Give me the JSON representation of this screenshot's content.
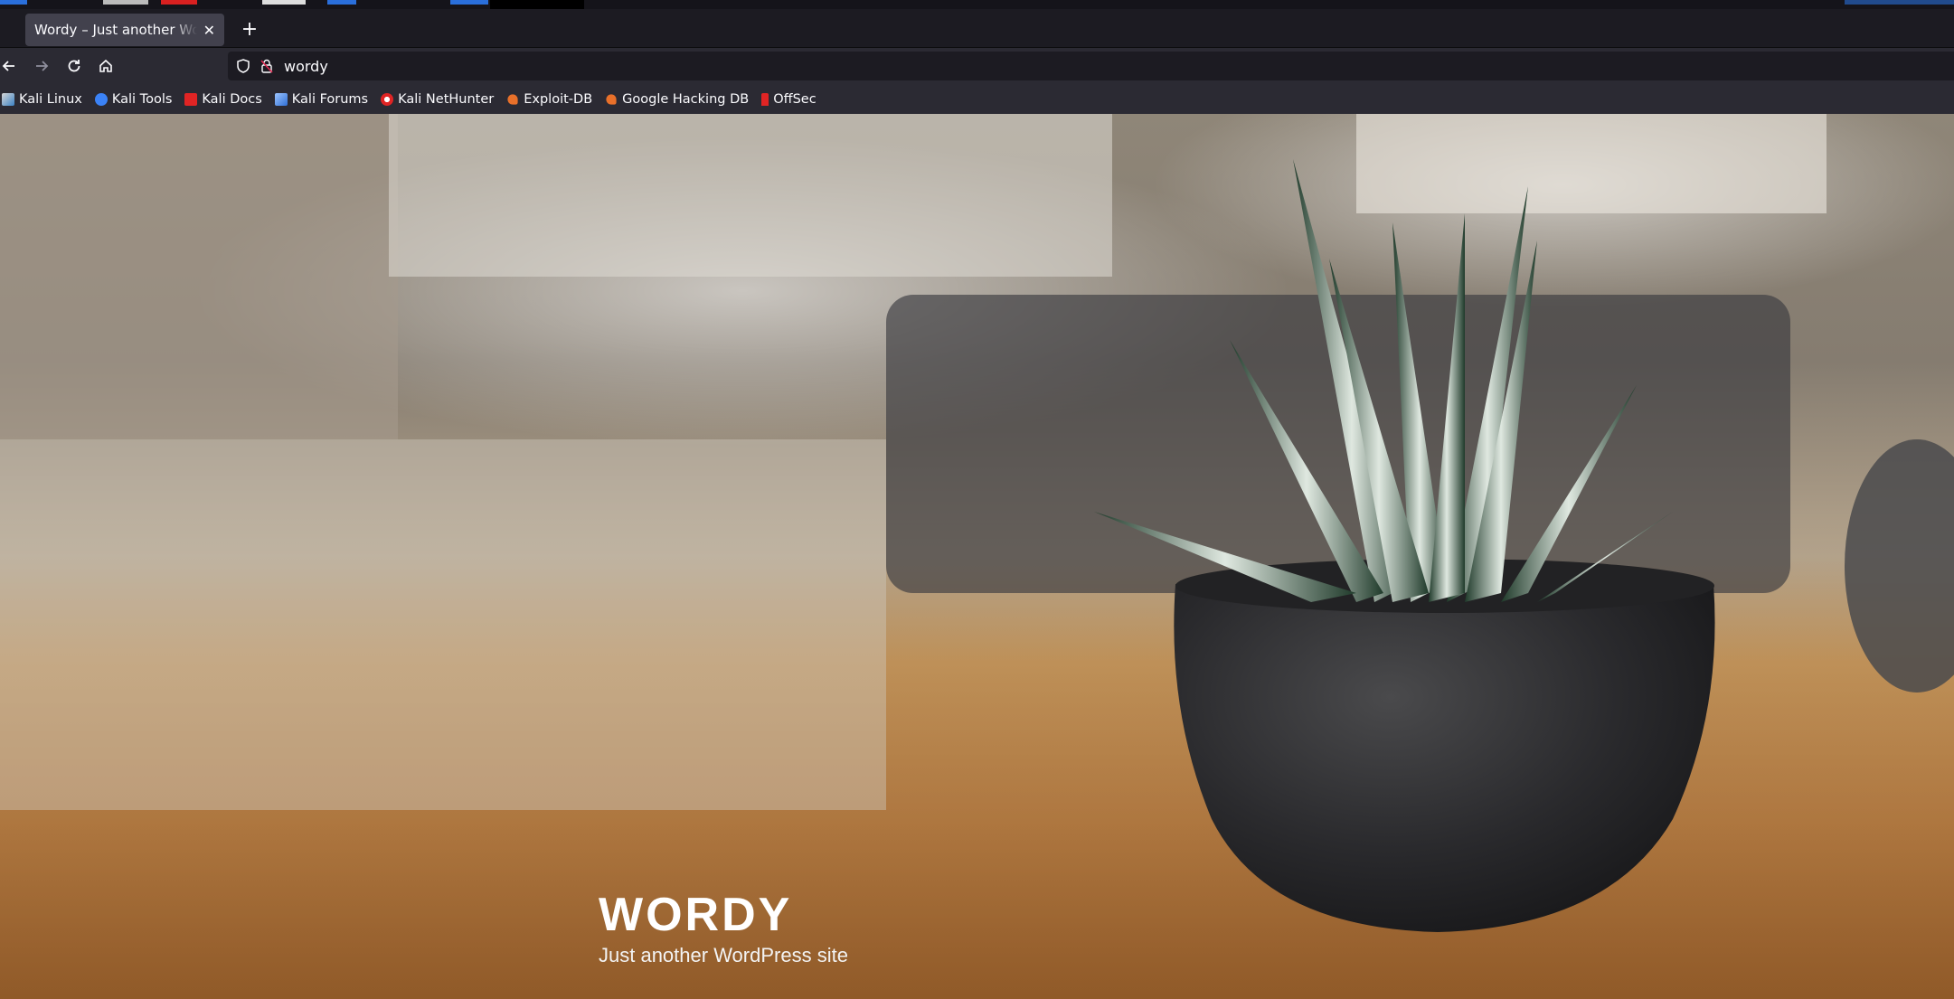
{
  "browser": {
    "tab": {
      "title": "Wordy – Just another WordPress site"
    },
    "url": "wordy"
  },
  "bookmarks": [
    {
      "label": "Kali Linux",
      "icon": "kali-dragon-icon"
    },
    {
      "label": "Kali Tools",
      "icon": "kali-tools-icon"
    },
    {
      "label": "Kali Docs",
      "icon": "kali-docs-icon"
    },
    {
      "label": "Kali Forums",
      "icon": "kali-forums-icon"
    },
    {
      "label": "Kali NetHunter",
      "icon": "nethunter-icon"
    },
    {
      "label": "Exploit-DB",
      "icon": "exploit-db-icon"
    },
    {
      "label": "Google Hacking DB",
      "icon": "ghdb-icon"
    },
    {
      "label": "OffSec",
      "icon": "offsec-icon"
    }
  ],
  "site": {
    "title": "WORDY",
    "tagline": "Just another WordPress site"
  },
  "colors": {
    "tab_active": "#42414d",
    "toolbar": "#2b2a33",
    "accent": "#00ddff"
  }
}
